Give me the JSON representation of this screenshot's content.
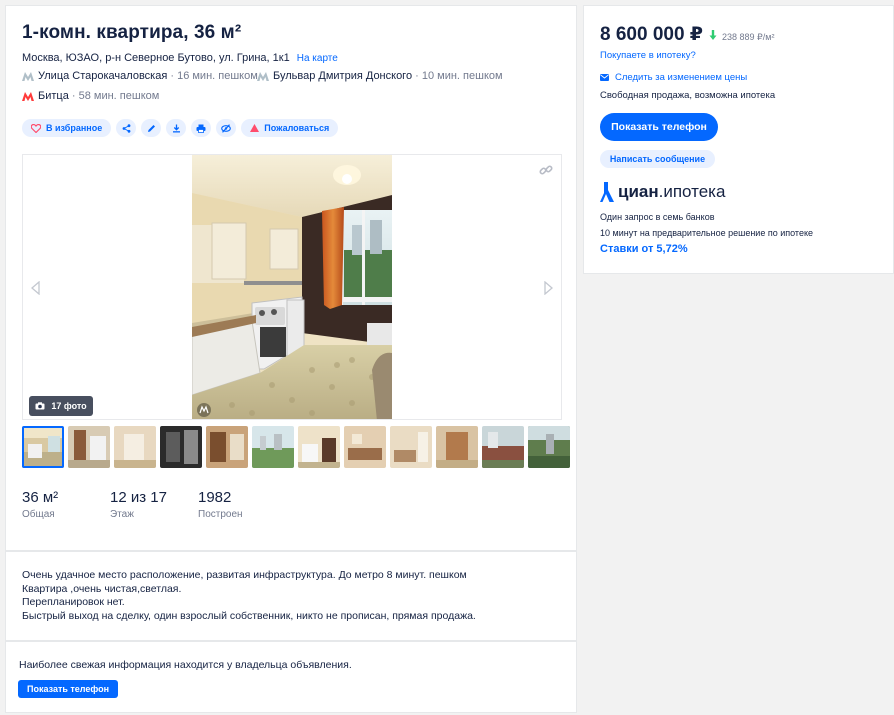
{
  "listing": {
    "title": "1-комн. квартира, 36 м²",
    "address": "Москва, ЮЗАО, р-н Северное Бутово, ул. Грина, 1к1",
    "map_link": "На карте",
    "metro": [
      {
        "name": "Улица Старокачаловская",
        "distance": "· 16 мин. пешком"
      },
      {
        "name": "Бульвар Дмитрия Донского",
        "distance": "· 10 мин. пешком"
      },
      {
        "name": "Битца",
        "distance": "· 58 мин. пешком"
      }
    ],
    "metro_color": "#b0bfc8",
    "metro_color_red": "#ff3b3b"
  },
  "actions": {
    "favorite_label": "В избранное",
    "complain_label": "Пожаловаться"
  },
  "gallery": {
    "photo_count": "17 фото"
  },
  "facts": [
    {
      "value": "36 м²",
      "label": "Общая"
    },
    {
      "value": "12 из 17",
      "label": "Этаж"
    },
    {
      "value": "1982",
      "label": "Построен"
    }
  ],
  "description": {
    "lines": [
      "Очень удачное место расположение, развитая инфраструктура. До метро 8 минут. пешком",
      "Квартира ,очень чистая,светлая.",
      "Перепланировок нет.",
      "Быстрый выход на сделку, один взрослый собственник, никто не прописан, прямая продажа."
    ]
  },
  "owner": {
    "text": "Наиболее свежая информация находится у владельца объявления.",
    "button": "Показать телефон"
  },
  "side": {
    "price": "8 600 000 ₽",
    "price_per_m2": "238 889 ₽/м²",
    "mortgage_link": "Покупаете в ипотеку?",
    "follow_price": "Следить за изменением цены",
    "sale_type": "Свободная продажа, возможна ипотека",
    "phone_button": "Показать телефон",
    "message_button": "Написать сообщение",
    "cian_brand": "циан",
    "cian_suffix": ".ипотека",
    "cian_line1": "Один запрос в семь банков",
    "cian_line2": "10 минут на предварительное решение по ипотеке",
    "rates": "Ставки от 5,72%"
  },
  "colors": {
    "accent": "#0468ff",
    "text": "#152242",
    "muted": "#737a8e",
    "price_down": "#2ecc71"
  }
}
